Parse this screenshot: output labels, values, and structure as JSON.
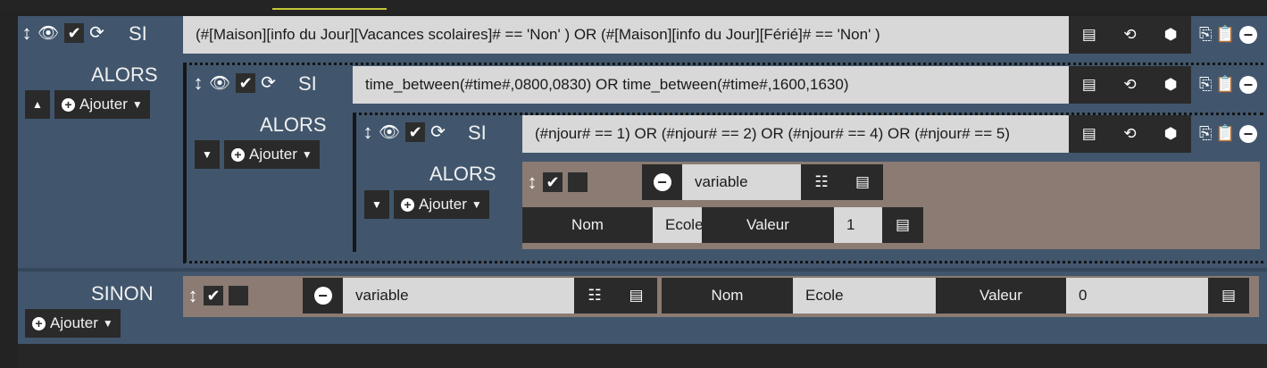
{
  "icons": {
    "move": "↕",
    "eye": "👁",
    "check": "✔",
    "refresh": "⟳",
    "list": "▤",
    "history": "⟲",
    "cube": "⬢",
    "copy": "⎘",
    "paste": "📋",
    "minus": "−",
    "plus": "+",
    "caret_down": "▼",
    "caret_up": "▲",
    "checklist": "☷"
  },
  "labels": {
    "si": "SI",
    "alors": "ALORS",
    "sinon": "SINON",
    "ajouter": "Ajouter"
  },
  "conditions": {
    "c1": "(#[Maison][info du Jour][Vacances scolaires]# == 'Non' )  OR (#[Maison][info du Jour][Férié]# == 'Non'  )",
    "c2": "time_between(#time#,0800,0830) OR time_between(#time#,1600,1630)",
    "c3": "(#njour# == 1) OR (#njour# == 2) OR (#njour# == 4) OR (#njour# == 5)"
  },
  "action_inner": {
    "type": "variable",
    "nom_label": "Nom",
    "nom_value": "Ecole",
    "valeur_label": "Valeur",
    "valeur_value": "1"
  },
  "action_sinon": {
    "type": "variable",
    "nom_label": "Nom",
    "nom_value": "Ecole",
    "valeur_label": "Valeur",
    "valeur_value": "0"
  },
  "colors": {
    "block_bg": "#41566d",
    "action_bg": "#8b7b72",
    "input_bg": "#d8d8d8",
    "dark_btn": "#2a2a2a",
    "tab_accent": "#c4c637"
  }
}
